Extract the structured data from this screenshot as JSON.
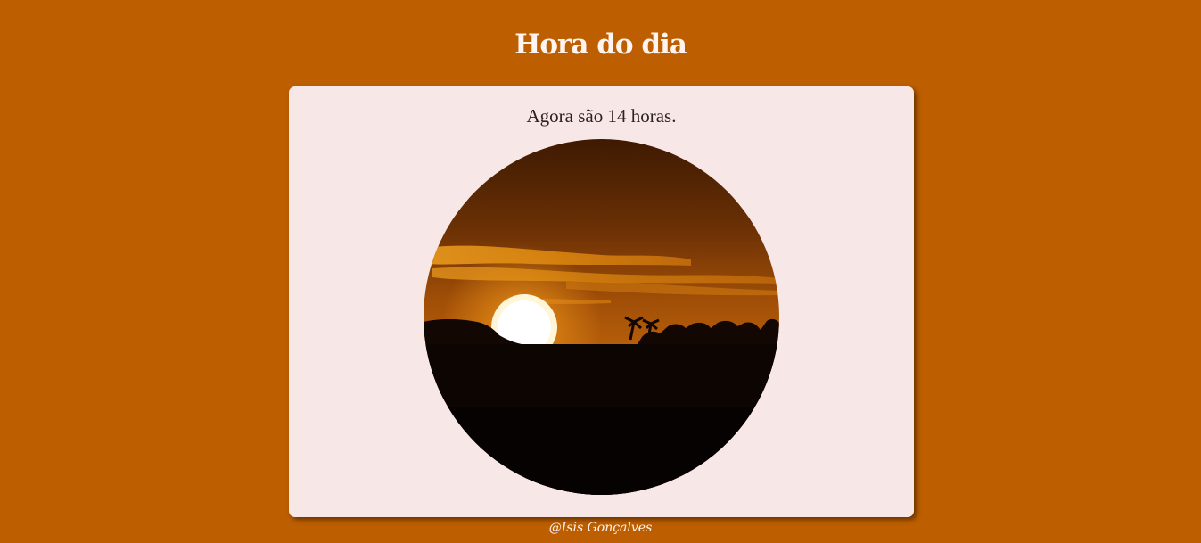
{
  "header": {
    "title": "Hora do dia"
  },
  "card": {
    "message": "Agora são 14 horas.",
    "image": {
      "icon": "sunset-photo"
    }
  },
  "footer": {
    "credit": "@Isis Gonçalves"
  },
  "colors": {
    "background": "#bd5e00",
    "card": "#f8e7e7",
    "title_text": "#fff4ef",
    "message_text": "#2b2323"
  }
}
